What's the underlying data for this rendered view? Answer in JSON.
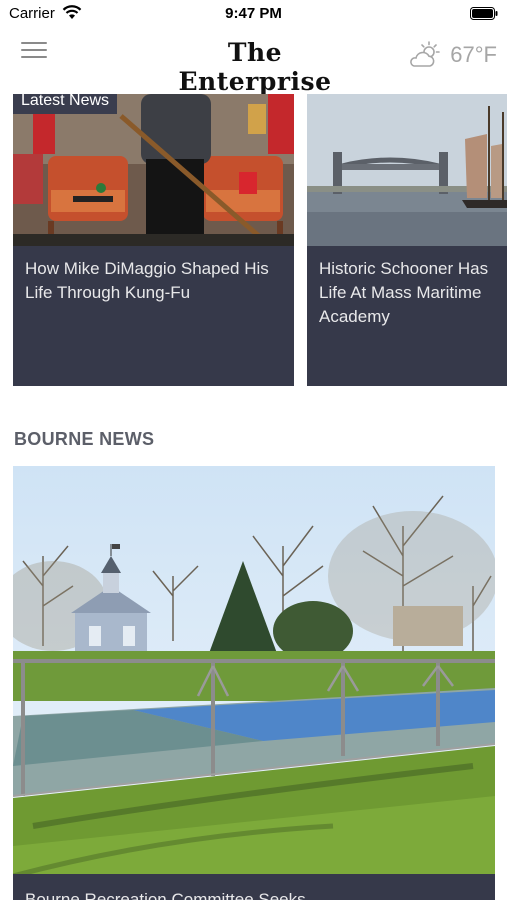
{
  "status_bar": {
    "carrier": "Carrier",
    "time": "9:47 PM"
  },
  "header": {
    "masthead": "The Enterprise",
    "weather_icon": "partly-cloudy-icon",
    "temperature": "67°F"
  },
  "carousel": {
    "badge": "Latest News",
    "cards": [
      {
        "title": "How Mike DiMaggio Shaped His Life Through Kung-Fu"
      },
      {
        "title": "Historic Schooner Has Life At Mass Maritime Academy"
      }
    ]
  },
  "section": {
    "title": "BOURNE NEWS",
    "hero_caption": "Bourne Recreation Committee Seeks"
  },
  "colors": {
    "card_bg": "#36394a",
    "badge_bg": "#3a3d4e",
    "section_title": "#5c5f69"
  }
}
